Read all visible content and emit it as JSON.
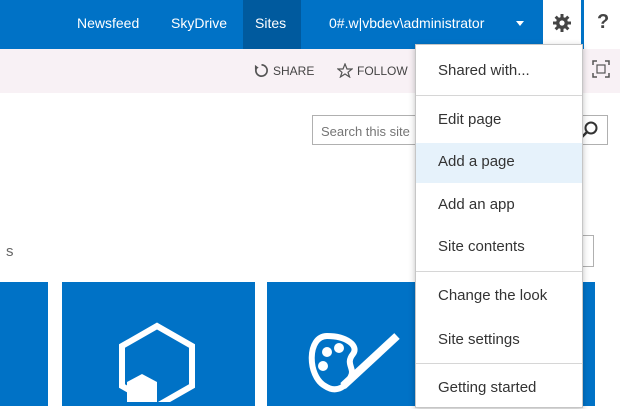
{
  "suite_bar": {
    "links": [
      {
        "label": "Newsfeed"
      },
      {
        "label": "SkyDrive"
      },
      {
        "label": "Sites"
      }
    ],
    "user": "0#.w|vbdev\\administrator",
    "help": "?"
  },
  "ribbon": {
    "share": "SHARE",
    "follow": "FOLLOW"
  },
  "search": {
    "placeholder": "Search this site"
  },
  "side_text": "s",
  "menu": {
    "items": [
      {
        "label": "Shared with..."
      },
      {
        "label": "Edit page"
      },
      {
        "label": "Add a page"
      },
      {
        "label": "Add an app"
      },
      {
        "label": "Site contents"
      },
      {
        "label": "Change the look"
      },
      {
        "label": "Site settings"
      },
      {
        "label": "Getting started"
      }
    ],
    "hovered": "Add a page"
  },
  "colors": {
    "suite_bar": "#0072c6",
    "ribbon": "#f8f1f5",
    "tiles": "#0072c6",
    "hover": "#e6f2fb"
  }
}
